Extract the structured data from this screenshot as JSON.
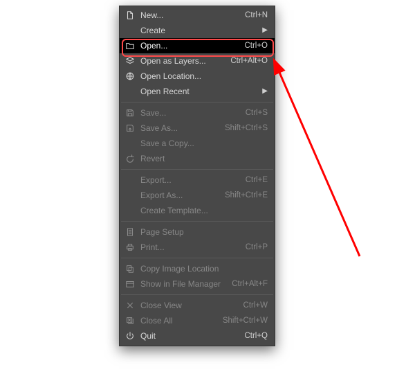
{
  "menu": {
    "sections": [
      {
        "items": [
          {
            "key": "new",
            "icon": "new-doc-icon",
            "label": "New...",
            "shortcut": "Ctrl+N",
            "enabled": true,
            "submenu": false
          },
          {
            "key": "create",
            "icon": "",
            "label": "Create",
            "shortcut": "",
            "enabled": true,
            "submenu": true
          },
          {
            "key": "open",
            "icon": "open-folder-icon",
            "label": "Open...",
            "shortcut": "Ctrl+O",
            "enabled": true,
            "submenu": false,
            "highlight": true
          },
          {
            "key": "open-layers",
            "icon": "open-layers-icon",
            "label": "Open as Layers...",
            "shortcut": "Ctrl+Alt+O",
            "enabled": true,
            "submenu": false
          },
          {
            "key": "open-location",
            "icon": "globe-icon",
            "label": "Open Location...",
            "shortcut": "",
            "enabled": true,
            "submenu": false
          },
          {
            "key": "open-recent",
            "icon": "",
            "label": "Open Recent",
            "shortcut": "",
            "enabled": true,
            "submenu": true
          }
        ]
      },
      {
        "items": [
          {
            "key": "save",
            "icon": "save-icon",
            "label": "Save...",
            "shortcut": "Ctrl+S",
            "enabled": false,
            "submenu": false
          },
          {
            "key": "save-as",
            "icon": "save-as-icon",
            "label": "Save As...",
            "shortcut": "Shift+Ctrl+S",
            "enabled": false,
            "submenu": false
          },
          {
            "key": "save-copy",
            "icon": "",
            "label": "Save a Copy...",
            "shortcut": "",
            "enabled": false,
            "submenu": false
          },
          {
            "key": "revert",
            "icon": "revert-icon",
            "label": "Revert",
            "shortcut": "",
            "enabled": false,
            "submenu": false
          }
        ]
      },
      {
        "items": [
          {
            "key": "export",
            "icon": "",
            "label": "Export...",
            "shortcut": "Ctrl+E",
            "enabled": false,
            "submenu": false
          },
          {
            "key": "export-as",
            "icon": "",
            "label": "Export As...",
            "shortcut": "Shift+Ctrl+E",
            "enabled": false,
            "submenu": false
          },
          {
            "key": "create-template",
            "icon": "",
            "label": "Create Template...",
            "shortcut": "",
            "enabled": false,
            "submenu": false
          }
        ]
      },
      {
        "items": [
          {
            "key": "page-setup",
            "icon": "page-setup-icon",
            "label": "Page Setup",
            "shortcut": "",
            "enabled": false,
            "submenu": false
          },
          {
            "key": "print",
            "icon": "print-icon",
            "label": "Print...",
            "shortcut": "Ctrl+P",
            "enabled": false,
            "submenu": false
          }
        ]
      },
      {
        "items": [
          {
            "key": "copy-image-location",
            "icon": "copy-location-icon",
            "label": "Copy Image Location",
            "shortcut": "",
            "enabled": false,
            "submenu": false
          },
          {
            "key": "show-in-file-manager",
            "icon": "file-manager-icon",
            "label": "Show in File Manager",
            "shortcut": "Ctrl+Alt+F",
            "enabled": false,
            "submenu": false
          }
        ]
      },
      {
        "items": [
          {
            "key": "close-view",
            "icon": "close-icon",
            "label": "Close View",
            "shortcut": "Ctrl+W",
            "enabled": false,
            "submenu": false
          },
          {
            "key": "close-all",
            "icon": "close-all-icon",
            "label": "Close All",
            "shortcut": "Shift+Ctrl+W",
            "enabled": false,
            "submenu": false
          },
          {
            "key": "quit",
            "icon": "quit-icon",
            "label": "Quit",
            "shortcut": "Ctrl+Q",
            "enabled": true,
            "submenu": false
          }
        ]
      }
    ]
  },
  "callout_color": "#ff0000"
}
